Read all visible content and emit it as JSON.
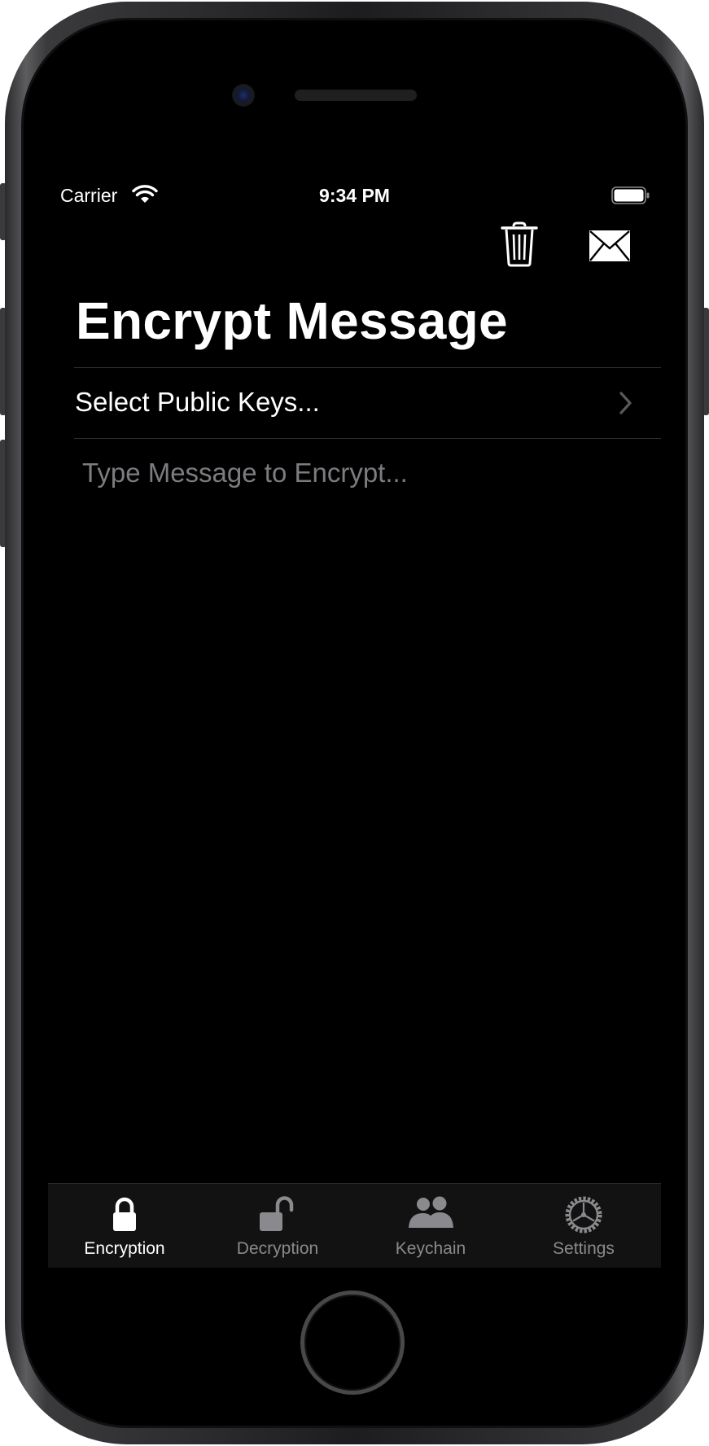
{
  "status_bar": {
    "carrier": "Carrier",
    "time": "9:34 PM"
  },
  "nav": {
    "title": "Encrypt Message",
    "trash_icon": "trash-icon",
    "compose_icon": "envelope-icon"
  },
  "form": {
    "select_keys_label": "Select Public Keys...",
    "message_placeholder": "Type Message to Encrypt...",
    "message_value": ""
  },
  "tabs": [
    {
      "label": "Encryption",
      "icon": "lock-closed-icon",
      "active": true
    },
    {
      "label": "Decryption",
      "icon": "lock-open-icon",
      "active": false
    },
    {
      "label": "Keychain",
      "icon": "people-icon",
      "active": false
    },
    {
      "label": "Settings",
      "icon": "gear-icon",
      "active": false
    }
  ],
  "colors": {
    "background": "#000000",
    "text": "#ffffff",
    "placeholder": "#7c7c80",
    "tab_inactive": "#8a8a8e",
    "tab_bar": "#121212"
  }
}
